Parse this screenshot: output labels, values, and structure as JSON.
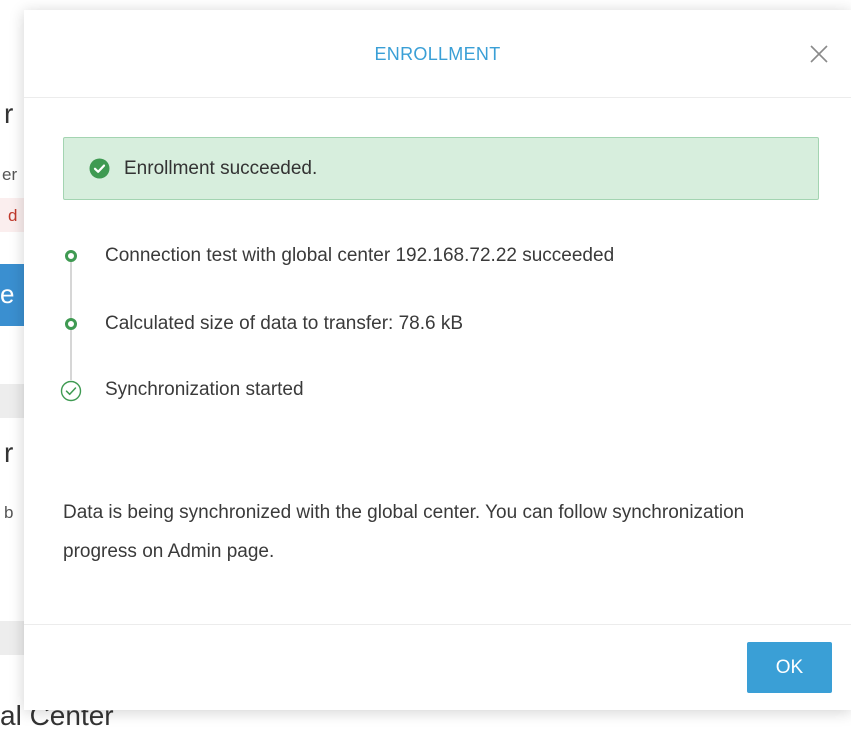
{
  "background": {
    "fragments": [
      "r",
      "er",
      "d",
      "e",
      "r",
      "b",
      "al Center"
    ]
  },
  "modal": {
    "title": "ENROLLMENT",
    "close_label": "X",
    "alert": {
      "text": "Enrollment succeeded."
    },
    "steps": [
      {
        "label": "Connection test with global center 192.168.72.22 succeeded",
        "status": "done"
      },
      {
        "label": "Calculated size of data to transfer: 78.6 kB",
        "status": "done"
      },
      {
        "label": "Synchronization started",
        "status": "active"
      }
    ],
    "info_text": "Data is being synchronized with the global center. You can follow synchronization progress on Admin page.",
    "ok_label": "OK"
  },
  "colors": {
    "accent": "#3a9fd6",
    "success_bg": "#d7eedd",
    "success_border": "#a3d4b1",
    "success_green": "#3f9a52"
  },
  "icons": {
    "close": "close-icon",
    "alert": "check-circle-filled-icon",
    "step_done": "circle-dot-icon",
    "step_active": "check-circle-outline-icon"
  }
}
